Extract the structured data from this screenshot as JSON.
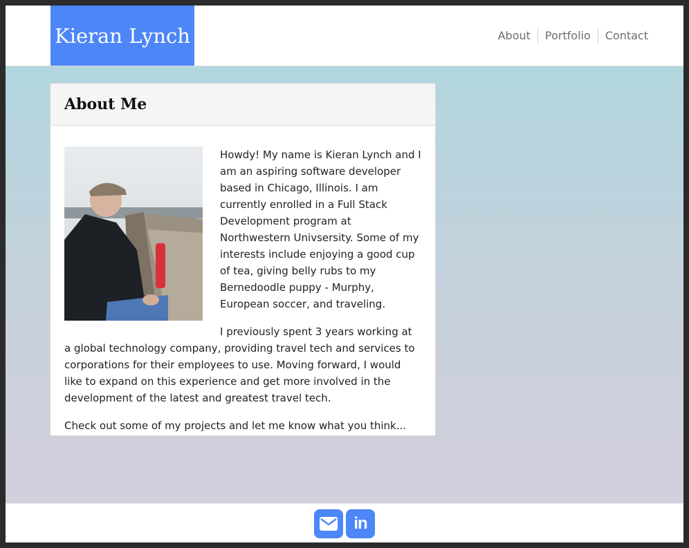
{
  "header": {
    "brand": "Kieran Lynch",
    "nav": [
      {
        "label": "About"
      },
      {
        "label": "Portfolio"
      },
      {
        "label": "Contact"
      }
    ]
  },
  "about": {
    "title": "About Me",
    "photo_icon": "profile-photo",
    "paragraphs": [
      "Howdy! My name is Kieran Lynch and I am an aspiring software developer based in Chicago, Illinois. I am currently enrolled in a Full Stack Development program at Northwestern Univsersity. Some of my interests include enjoying a good cup of tea, giving belly rubs to my Bernedoodle puppy - Murphy, European soccer, and traveling.",
      "I previously spent 3 years working at a global technology company, providing travel tech and services to corporations for their employees to use. Moving forward, I would like to expand on this experience and get more involved in the development of the latest and greatest travel tech.",
      "Check out some of my projects and let me know what you think..."
    ]
  },
  "footer": {
    "email_icon": "envelope-icon",
    "linkedin_icon": "linkedin-icon",
    "linkedin_glyph": "in"
  },
  "colors": {
    "accent": "#4d86f7",
    "gradient_top": "#b2d6df",
    "gradient_bottom": "#d3cfdc"
  }
}
